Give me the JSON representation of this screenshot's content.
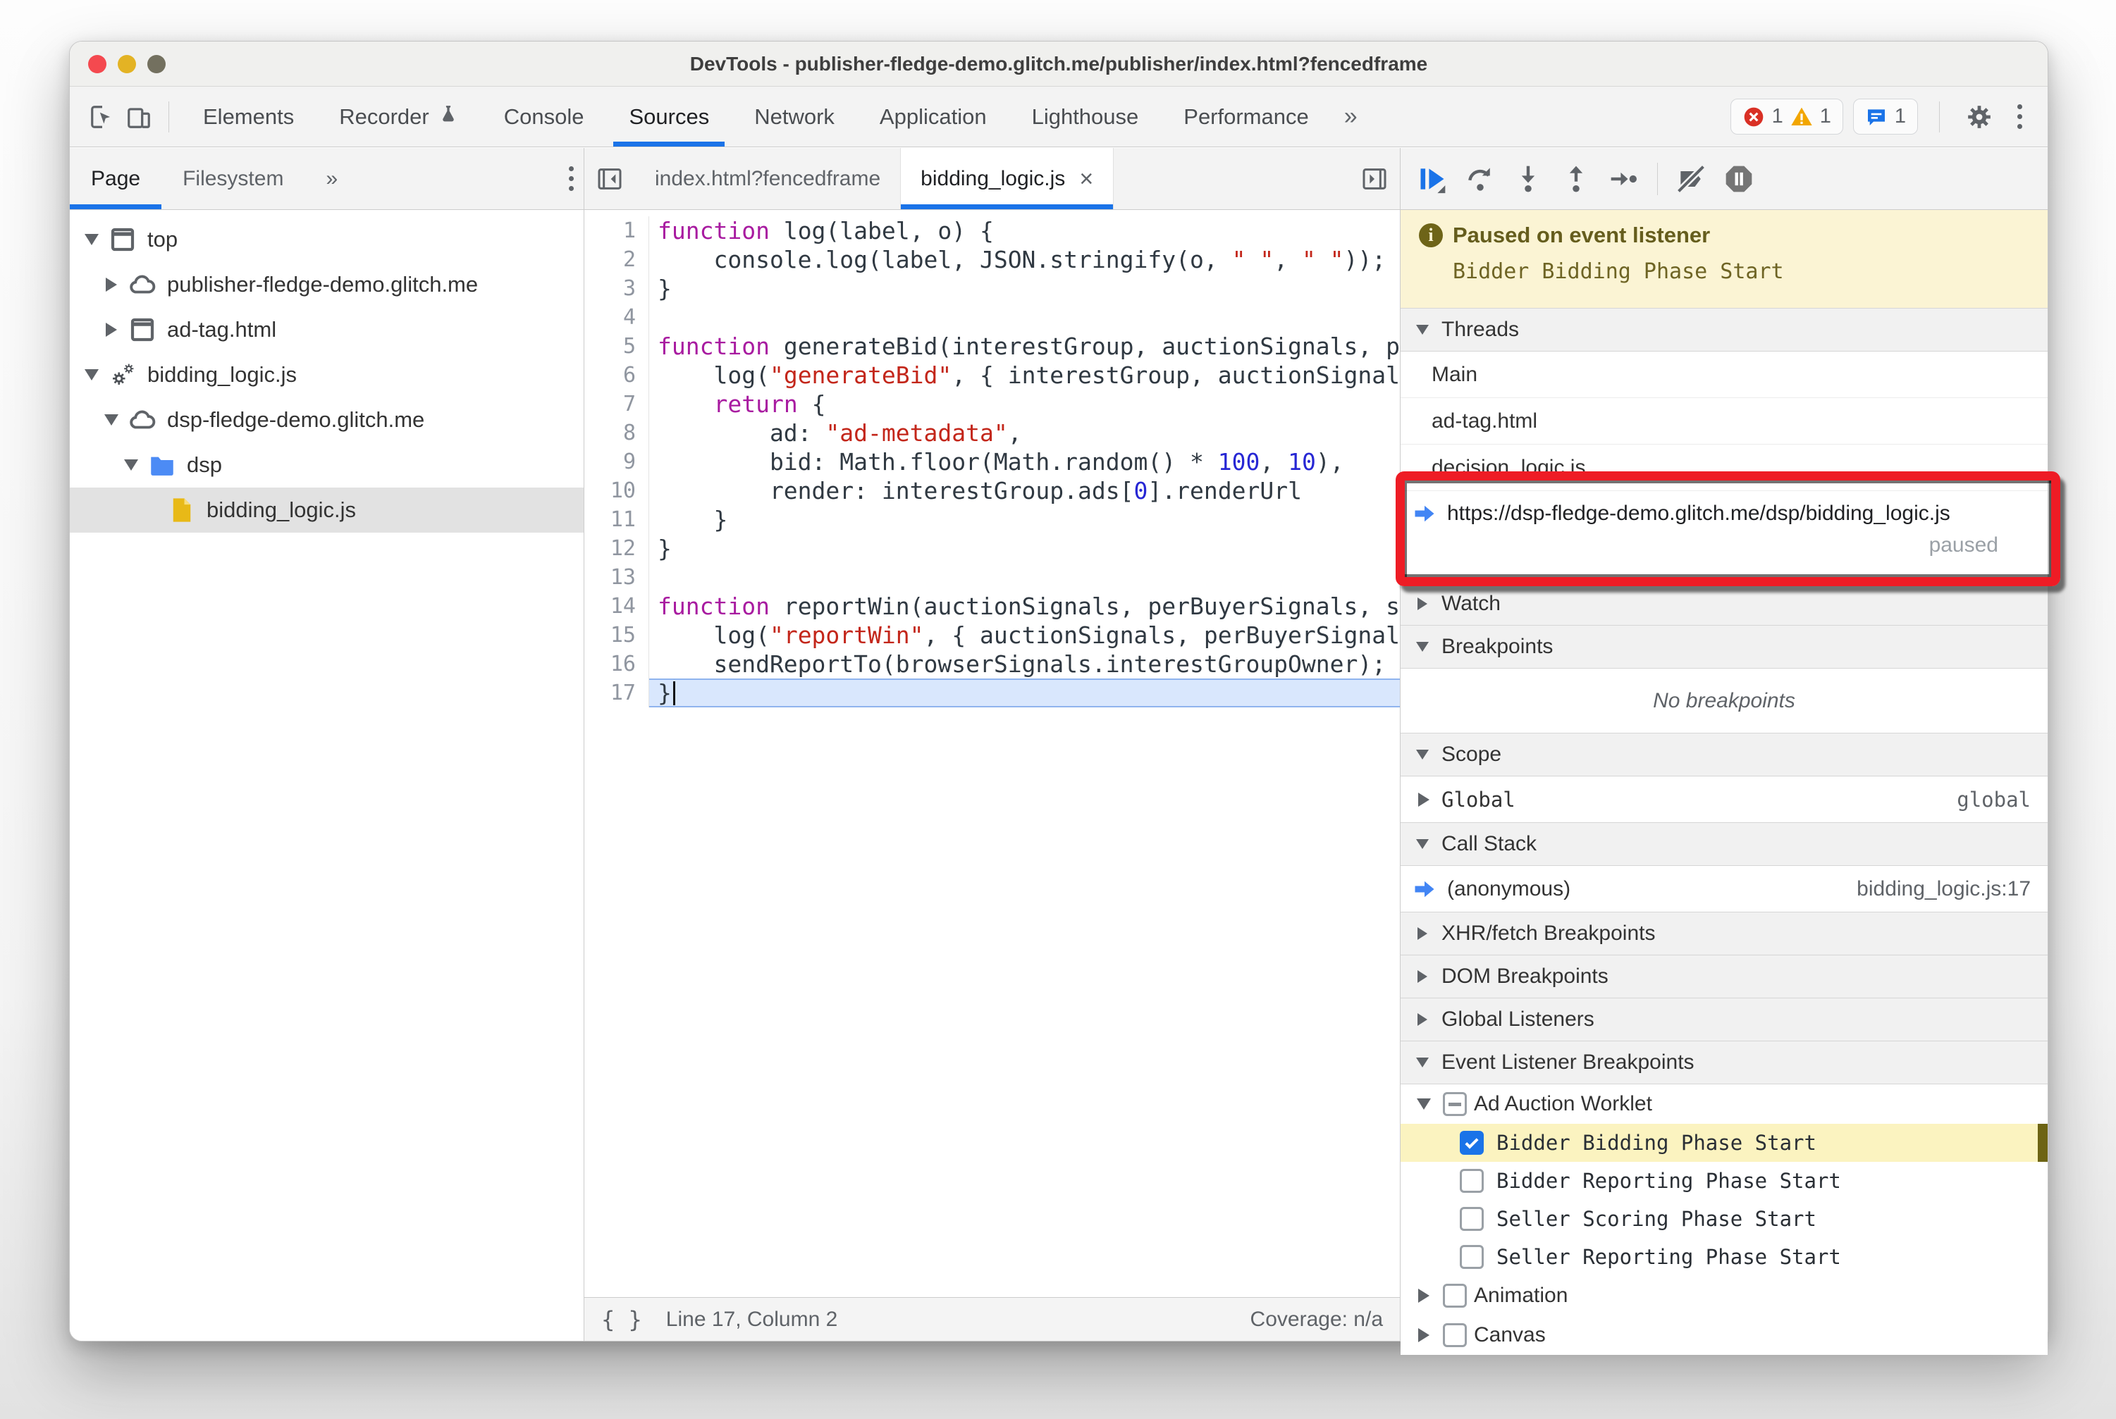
{
  "window": {
    "title": "DevTools - publisher-fledge-demo.glitch.me/publisher/index.html?fencedframe"
  },
  "toolbar": {
    "tabs": [
      {
        "label": "Elements"
      },
      {
        "label": "Recorder",
        "icon": "flask-icon"
      },
      {
        "label": "Console"
      },
      {
        "label": "Sources"
      },
      {
        "label": "Network"
      },
      {
        "label": "Application"
      },
      {
        "label": "Lighthouse"
      },
      {
        "label": "Performance"
      }
    ],
    "active_tab": "Sources",
    "more_tabs_glyph": "»",
    "badges": {
      "errors": "1",
      "warnings": "1",
      "issues": "1"
    }
  },
  "navigator": {
    "tabs": [
      "Page",
      "Filesystem"
    ],
    "active_tab": "Page",
    "more_tabs_glyph": "»",
    "tree": [
      {
        "label": "top",
        "icon": "frame-icon",
        "level": 0,
        "expand": "open"
      },
      {
        "label": "publisher-fledge-demo.glitch.me",
        "icon": "cloud-icon",
        "level": 1,
        "expand": "closed"
      },
      {
        "label": "ad-tag.html",
        "icon": "frame-icon",
        "level": 1,
        "expand": "closed"
      },
      {
        "label": "bidding_logic.js",
        "icon": "worklet-gears-icon",
        "level": 0,
        "expand": "open"
      },
      {
        "label": "dsp-fledge-demo.glitch.me",
        "icon": "cloud-icon",
        "level": 1,
        "expand": "open"
      },
      {
        "label": "dsp",
        "icon": "folder-icon",
        "level": 2,
        "expand": "open"
      },
      {
        "label": "bidding_logic.js",
        "icon": "js-file-icon",
        "level": 3,
        "expand": "none",
        "selected": true
      }
    ]
  },
  "editor": {
    "tabs": [
      {
        "label": "index.html?fencedframe",
        "active": false
      },
      {
        "label": "bidding_logic.js",
        "active": true,
        "close_glyph": "×"
      }
    ],
    "lines": [
      {
        "n": 1,
        "segs": [
          [
            "kw",
            "function"
          ],
          [
            "pl",
            " log(label, o) {"
          ]
        ]
      },
      {
        "n": 2,
        "segs": [
          [
            "pl",
            "    console.log(label, JSON.stringify(o, "
          ],
          [
            "str",
            "\" \""
          ],
          [
            "pl",
            ", "
          ],
          [
            "str",
            "\" \""
          ],
          [
            "pl",
            "));"
          ]
        ]
      },
      {
        "n": 3,
        "segs": [
          [
            "pl",
            "}"
          ]
        ]
      },
      {
        "n": 4,
        "segs": []
      },
      {
        "n": 5,
        "segs": [
          [
            "kw",
            "function"
          ],
          [
            "pl",
            " generateBid(interestGroup, auctionSignals, perBuyerSignals, trustedBiddingSignals, browserSignals) {"
          ]
        ]
      },
      {
        "n": 6,
        "segs": [
          [
            "pl",
            "    log("
          ],
          [
            "str",
            "\"generateBid\""
          ],
          [
            "pl",
            ", { interestGroup, auctionSignals, perBuyerSignals, trustedBiddingSignals, browserSignals });"
          ]
        ]
      },
      {
        "n": 7,
        "segs": [
          [
            "pl",
            "    "
          ],
          [
            "kw",
            "return"
          ],
          [
            "pl",
            " {"
          ]
        ]
      },
      {
        "n": 8,
        "segs": [
          [
            "pl",
            "        ad: "
          ],
          [
            "str",
            "\"ad-metadata\""
          ],
          [
            "pl",
            ","
          ]
        ]
      },
      {
        "n": 9,
        "segs": [
          [
            "pl",
            "        bid: Math.floor(Math.random() * "
          ],
          [
            "num",
            "100"
          ],
          [
            "pl",
            ", "
          ],
          [
            "num",
            "10"
          ],
          [
            "pl",
            "),"
          ]
        ]
      },
      {
        "n": 10,
        "segs": [
          [
            "pl",
            "        render: interestGroup.ads["
          ],
          [
            "num",
            "0"
          ],
          [
            "pl",
            "].renderUrl"
          ]
        ]
      },
      {
        "n": 11,
        "segs": [
          [
            "pl",
            "    }"
          ]
        ]
      },
      {
        "n": 12,
        "segs": [
          [
            "pl",
            "}"
          ]
        ]
      },
      {
        "n": 13,
        "segs": []
      },
      {
        "n": 14,
        "segs": [
          [
            "kw",
            "function"
          ],
          [
            "pl",
            " reportWin(auctionSignals, perBuyerSignals, sellerSignals, browserSignals) {"
          ]
        ]
      },
      {
        "n": 15,
        "segs": [
          [
            "pl",
            "    log("
          ],
          [
            "str",
            "\"reportWin\""
          ],
          [
            "pl",
            ", { auctionSignals, perBuyerSignals, sellerSignals, browserSignals });"
          ]
        ]
      },
      {
        "n": 16,
        "segs": [
          [
            "pl",
            "    sendReportTo(browserSignals.interestGroupOwner);"
          ]
        ]
      },
      {
        "n": 17,
        "segs": [
          [
            "pl",
            "}"
          ]
        ],
        "paused": true
      }
    ],
    "status": {
      "format_glyph": "{ }",
      "line_col": "Line 17, Column 2",
      "coverage": "Coverage: n/a"
    }
  },
  "debugger": {
    "paused_banner": {
      "info_glyph": "i",
      "title": "Paused on event listener",
      "detail": "Bidder Bidding Phase Start"
    },
    "threads": {
      "title": "Threads",
      "items": [
        {
          "label": "Main"
        },
        {
          "label": "ad-tag.html"
        },
        {
          "label": "decision_logic.js"
        },
        {
          "label": "https://dsp-fledge-demo.glitch.me/dsp/bidding_logic.js",
          "status": "paused",
          "current": true
        }
      ]
    },
    "watch": {
      "title": "Watch"
    },
    "breakpoints": {
      "title": "Breakpoints",
      "empty": "No breakpoints"
    },
    "scope": {
      "title": "Scope",
      "items": [
        {
          "label": "Global",
          "value": "global"
        }
      ]
    },
    "call_stack": {
      "title": "Call Stack",
      "items": [
        {
          "label": "(anonymous)",
          "location": "bidding_logic.js:17",
          "current": true
        }
      ]
    },
    "collapsed_sections": [
      "XHR/fetch Breakpoints",
      "DOM Breakpoints",
      "Global Listeners"
    ],
    "event_listener_breakpoints": {
      "title": "Event Listener Breakpoints",
      "groups": [
        {
          "label": "Ad Auction Worklet",
          "state": "indeterminate",
          "expand": "open",
          "children": [
            {
              "label": "Bidder Bidding Phase Start",
              "checked": true,
              "highlight": true
            },
            {
              "label": "Bidder Reporting Phase Start",
              "checked": false
            },
            {
              "label": "Seller Scoring Phase Start",
              "checked": false
            },
            {
              "label": "Seller Reporting Phase Start",
              "checked": false
            }
          ]
        },
        {
          "label": "Animation",
          "state": "unchecked",
          "expand": "closed",
          "children": []
        },
        {
          "label": "Canvas",
          "state": "unchecked",
          "expand": "closed",
          "children": []
        }
      ]
    }
  },
  "colors": {
    "accent": "#1a73e8",
    "error": "#d93025",
    "warning": "#f29900",
    "annotation": "#ee1c25",
    "paused_banner_bg": "#fbf4d4"
  }
}
